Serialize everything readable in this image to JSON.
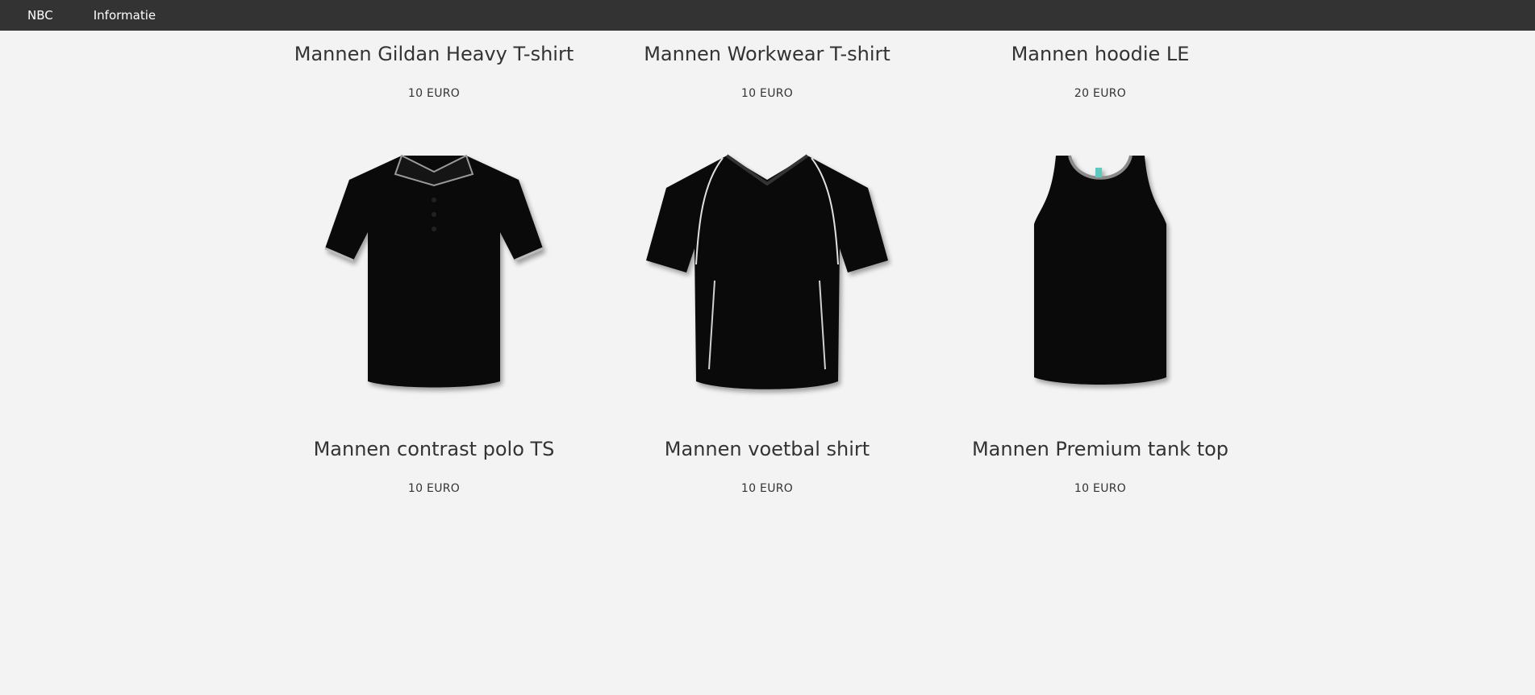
{
  "nav": {
    "items": [
      {
        "label": "NBC"
      },
      {
        "label": "Informatie"
      }
    ]
  },
  "products": [
    {
      "title": "Mannen Gildan Heavy T-shirt",
      "price": "10 EURO",
      "icon": "tshirt-icon"
    },
    {
      "title": "Mannen Workwear T-shirt",
      "price": "10 EURO",
      "icon": "tshirt-icon"
    },
    {
      "title": "Mannen hoodie LE",
      "price": "20 EURO",
      "icon": "hoodie-icon"
    },
    {
      "title": "Mannen contrast polo TS",
      "price": "10 EURO",
      "icon": "polo-icon"
    },
    {
      "title": "Mannen voetbal shirt",
      "price": "10 EURO",
      "icon": "football-shirt-icon"
    },
    {
      "title": "Mannen Premium tank top",
      "price": "10 EURO",
      "icon": "tank-top-icon"
    }
  ],
  "colors": {
    "navbar": "#333333",
    "background": "#f3f3f3",
    "garment": "#0a0a0a"
  }
}
